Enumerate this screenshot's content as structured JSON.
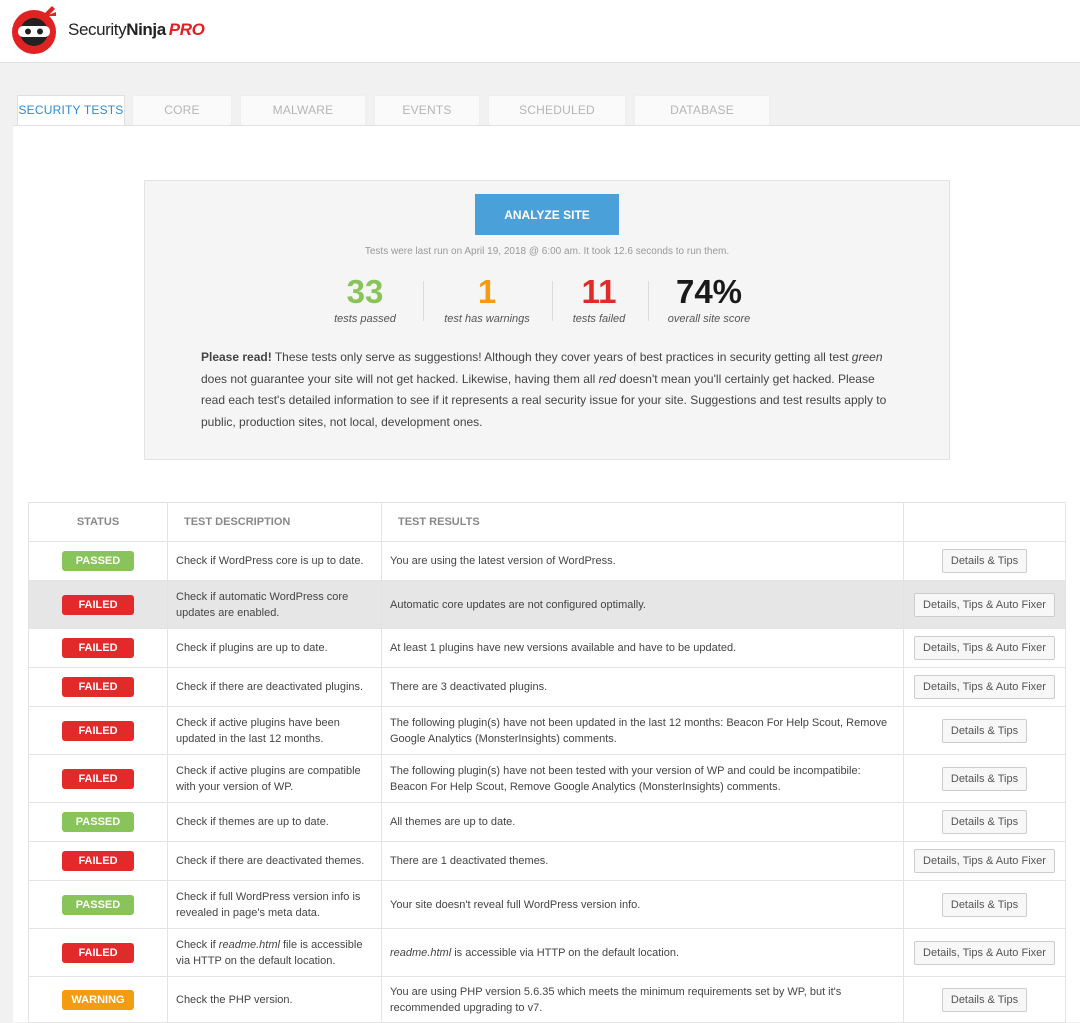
{
  "brand": {
    "name_part1": "Security",
    "name_part2": "Ninja",
    "suffix": "PRO"
  },
  "tabs": [
    {
      "label": "Security Tests",
      "active": true
    },
    {
      "label": "Core Scanner"
    },
    {
      "label": "Malware Scanner"
    },
    {
      "label": "Events Logger"
    },
    {
      "label": "Scheduled Scanner"
    },
    {
      "label": "Database Optimizer"
    }
  ],
  "summary": {
    "analyze_label": "ANALYZE SITE",
    "last_run": "Tests were last run on April 19, 2018 @ 6:00 am. It took 12.6 seconds to run them.",
    "stats": [
      {
        "value": "33",
        "label": "tests passed",
        "color": "#88c45a"
      },
      {
        "value": "1",
        "label": "test has warnings",
        "color": "#f39c12"
      },
      {
        "value": "11",
        "label": "tests failed",
        "color": "#e22a2a"
      },
      {
        "value": "74%",
        "label": "overall site score",
        "color": "#1a1a1a"
      }
    ],
    "notice": {
      "lead": "Please read!",
      "text1": " These tests only serve as suggestions! Although they cover years of best practices in security getting all test ",
      "em1": "green",
      "text2": " does not guarantee your site will not get hacked. Likewise, having them all ",
      "em2": "red",
      "text3": " doesn't mean you'll certainly get hacked. Please read each test's detailed information to see if it represents a real security issue for your site. Suggestions and test results apply to public, production sites, not local, development ones."
    }
  },
  "table": {
    "headers": {
      "status": "Status",
      "description": "Test Description",
      "results": "Test Results"
    },
    "rows": [
      {
        "status": "PASSED",
        "desc": "Check if WordPress core is up to date.",
        "result": "You are using the latest version of WordPress.",
        "action": "Details & Tips"
      },
      {
        "status": "FAILED",
        "desc": "Check if automatic WordPress core updates are enabled.",
        "result": "Automatic core updates are not configured optimally.",
        "action": "Details, Tips & Auto Fixer"
      },
      {
        "status": "FAILED",
        "desc": "Check if plugins are up to date.",
        "result": "At least 1 plugins have new versions available and have to be updated.",
        "action": "Details, Tips & Auto Fixer"
      },
      {
        "status": "FAILED",
        "desc": "Check if there are deactivated plugins.",
        "result": "There are 3 deactivated plugins.",
        "action": "Details, Tips & Auto Fixer"
      },
      {
        "status": "FAILED",
        "desc": "Check if active plugins have been updated in the last 12 months.",
        "result": "The following plugin(s) have not been updated in the last 12 months: Beacon For Help Scout, Remove Google Analytics (MonsterInsights) comments.",
        "action": "Details & Tips"
      },
      {
        "status": "FAILED",
        "desc": "Check if active plugins are compatible with your version of WP.",
        "result": "The following plugin(s) have not been tested with your version of WP and could be incompatibile: Beacon For Help Scout, Remove Google Analytics (MonsterInsights) comments.",
        "action": "Details & Tips"
      },
      {
        "status": "PASSED",
        "desc": "Check if themes are up to date.",
        "result": "All themes are up to date.",
        "action": "Details & Tips"
      },
      {
        "status": "FAILED",
        "desc": "Check if there are deactivated themes.",
        "result": "There are 1 deactivated themes.",
        "action": "Details, Tips & Auto Fixer"
      },
      {
        "status": "PASSED",
        "desc": "Check if full WordPress version info is revealed in page's meta data.",
        "result": "Your site doesn't reveal full WordPress version info.",
        "action": "Details & Tips"
      },
      {
        "status": "FAILED",
        "desc_pre": "Check if ",
        "desc_em": "readme.html",
        "desc_post": " file is accessible via HTTP on the default location.",
        "result_em": "readme.html",
        "result_post": " is accessible via HTTP on the default location.",
        "action": "Details, Tips & Auto Fixer"
      },
      {
        "status": "WARNING",
        "desc": "Check the PHP version.",
        "result": "You are using PHP version 5.6.35 which meets the minimum requirements set by WP, but it's recommended upgrading to v7.",
        "action": "Details & Tips"
      }
    ]
  }
}
